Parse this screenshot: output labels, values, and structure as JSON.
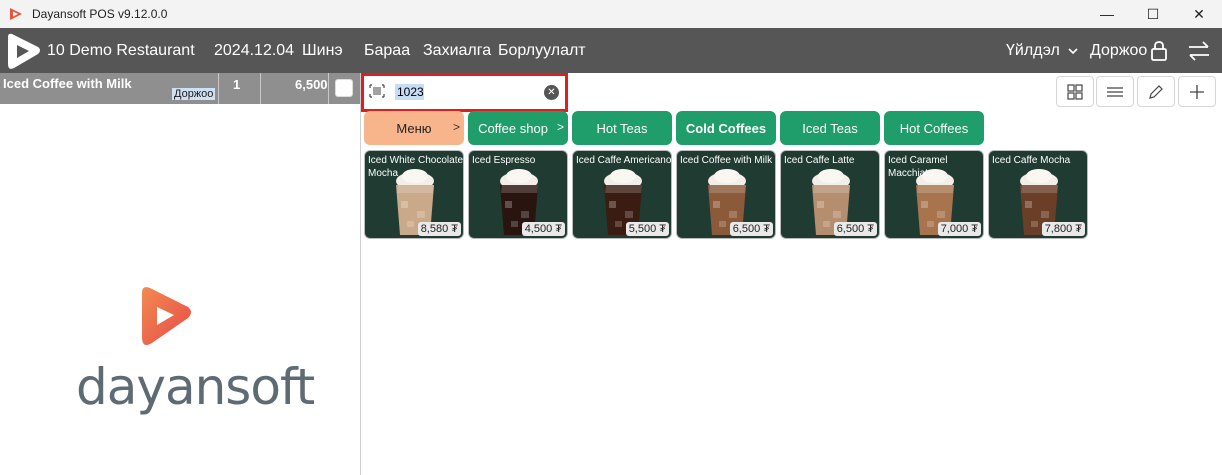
{
  "window": {
    "title": "Dayansoft POS v9.12.0.0",
    "controls": {
      "minimize": "—",
      "maximize": "☐",
      "close": "✕"
    }
  },
  "appbar": {
    "restaurant": "10 Demo Restaurant",
    "date": "2024.12.04",
    "new": "Шинэ",
    "nav": [
      "Бараа",
      "Захиалга",
      "Борлуулалт"
    ],
    "mode": "Үйлдэл",
    "user": "Доржоо"
  },
  "order": {
    "item_name": "Iced Coffee with Milk",
    "waiter": "Доржоо",
    "qty": "1",
    "price": "6,500"
  },
  "brand": {
    "text": "dayansoft"
  },
  "search": {
    "value": "1023"
  },
  "categories": [
    {
      "label": "Меню",
      "arrow": ">"
    },
    {
      "label": "Coffee shop",
      "arrow": ">"
    },
    {
      "label": "Hot Teas"
    },
    {
      "label": "Cold Coffees"
    },
    {
      "label": "Iced Teas"
    },
    {
      "label": "Hot Coffees"
    }
  ],
  "products": [
    {
      "name": "Iced White Chocolate Mocha",
      "price": "8,580 ₮",
      "tone": "#c9a98a"
    },
    {
      "name": "Iced Espresso",
      "price": "4,500 ₮",
      "tone": "#2a1410"
    },
    {
      "name": "Iced Caffe Americano",
      "price": "5,500 ₮",
      "tone": "#3a1c12"
    },
    {
      "name": "Iced Coffee with Milk",
      "price": "6,500 ₮",
      "tone": "#8a5a3a"
    },
    {
      "name": "Iced Caffe Latte",
      "price": "6,500 ₮",
      "tone": "#b58e70"
    },
    {
      "name": "Iced Caramel Macchiato",
      "price": "7,000 ₮",
      "tone": "#a7744d"
    },
    {
      "name": "Iced Caffe Mocha",
      "price": "7,800 ₮",
      "tone": "#6b3e28"
    }
  ],
  "colors": {
    "appbar": "#565656",
    "category_green": "#1f9d6b",
    "category_menu": "#f8b58c",
    "search_border": "#e01e1e",
    "brand_orange": "#ef6a4b"
  }
}
